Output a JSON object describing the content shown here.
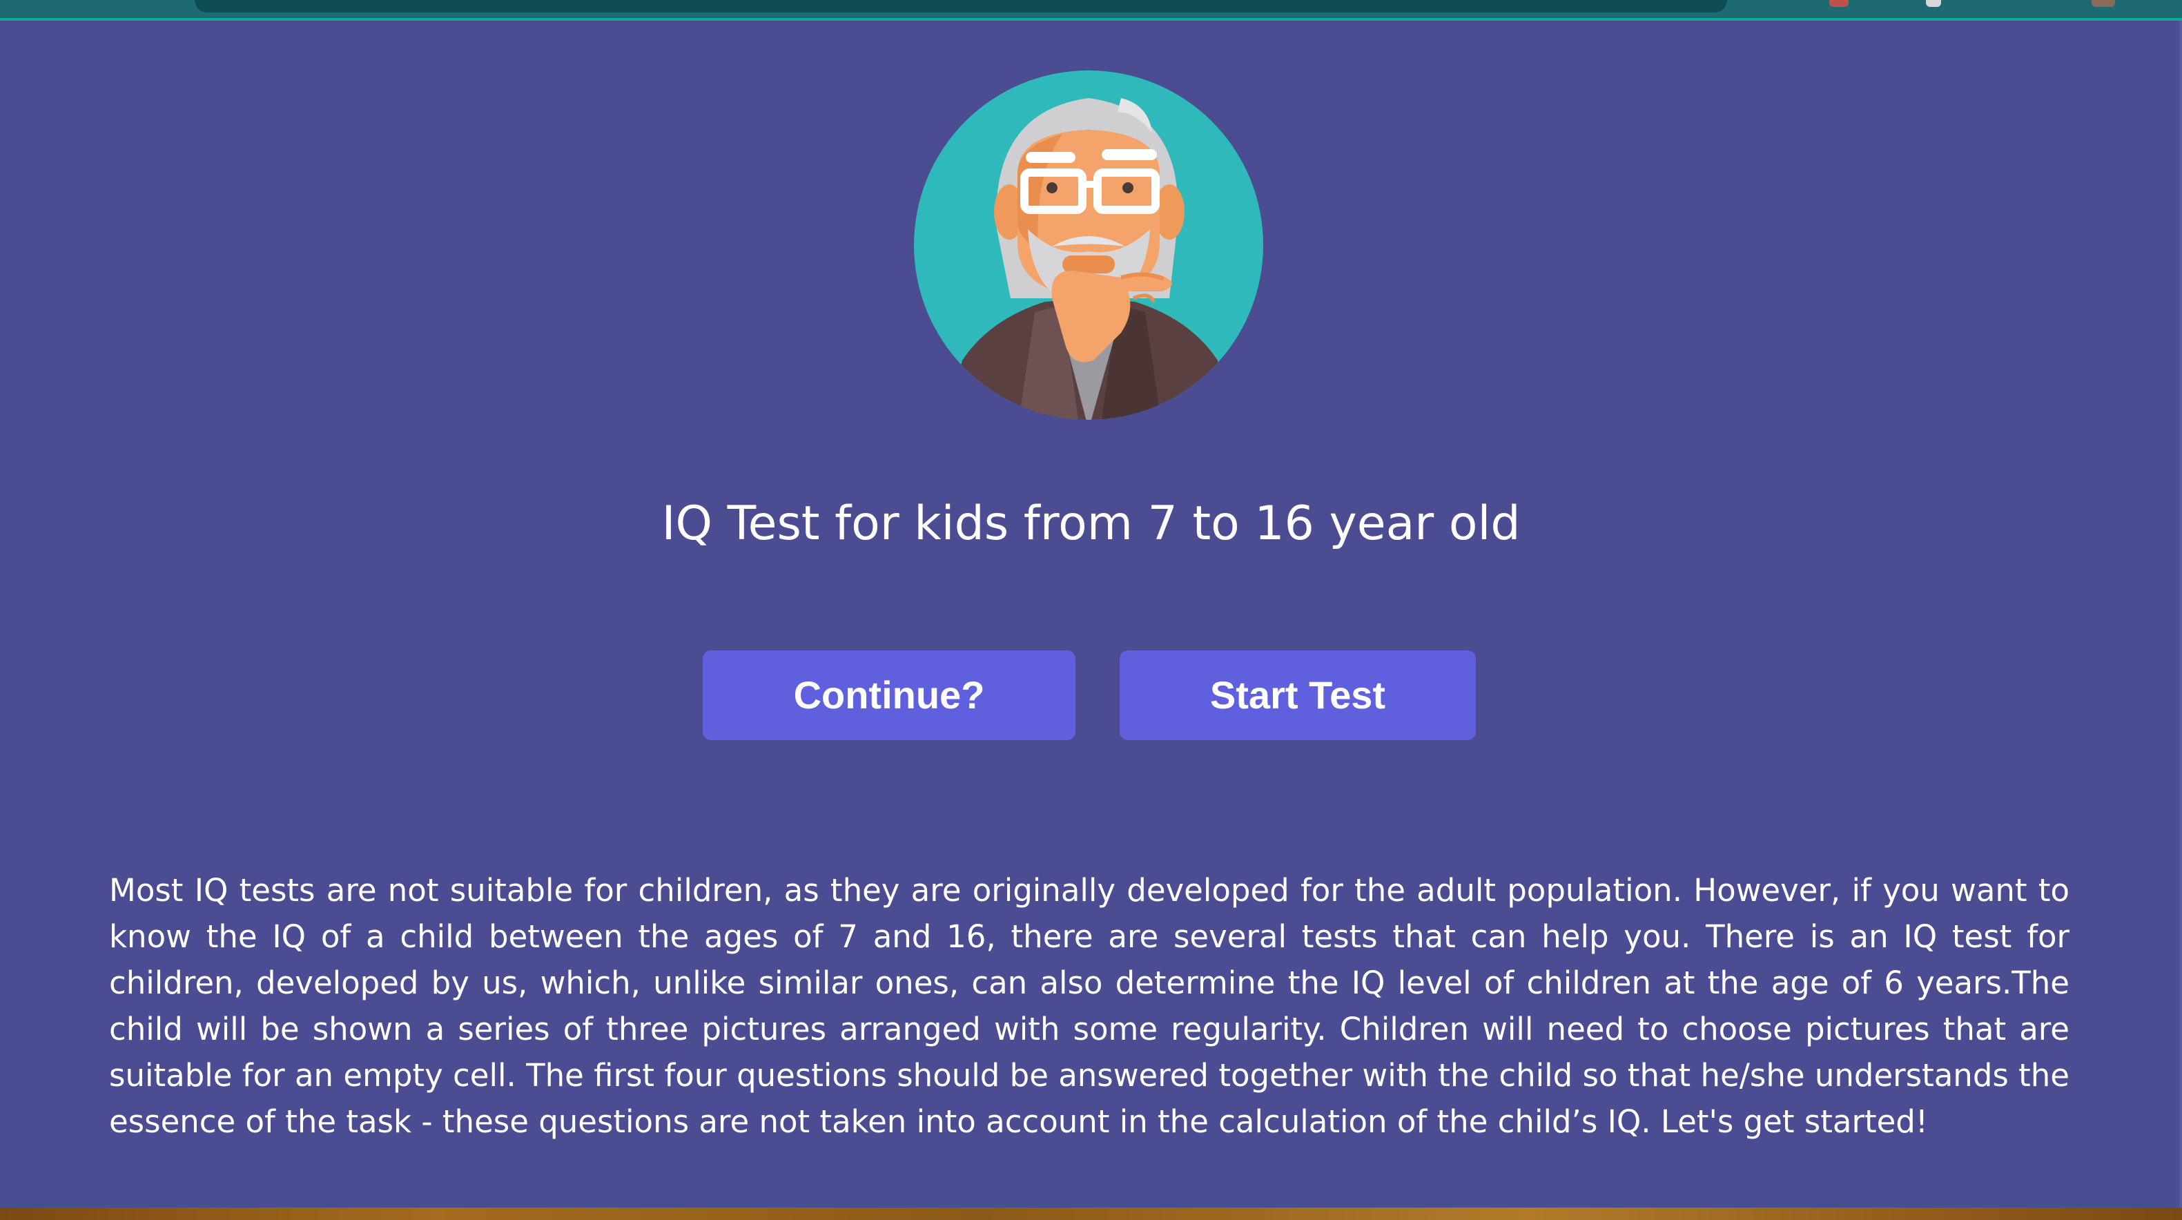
{
  "page": {
    "title": "IQ Test for kids from 7 to 16 year old",
    "description": "Most IQ tests are not suitable for children, as they are originally developed for the adult population. However, if you want to know the IQ of a child between the ages of 7 and 16, there are several tests that can help you. There is an IQ test for children, developed by us, which, unlike similar ones, can also determine the IQ level of children at the age of 6 years.The child will be shown a series of three pictures arranged with some regularity. Children will need to choose pictures that are suitable for an empty cell. The first four questions should be answered together with the child so that he/she understands the essence of the task - these questions are not taken into account in the calculation of the child’s IQ. Let's get started!"
  },
  "actions": {
    "continue_label": "Continue?",
    "start_label": "Start Test"
  },
  "avatar": {
    "icon": "thinking-old-man-avatar-icon"
  },
  "colors": {
    "background": "#4c4c92",
    "button": "#6060de",
    "avatar_circle": "#2fb9bb",
    "text": "#ffffff"
  }
}
